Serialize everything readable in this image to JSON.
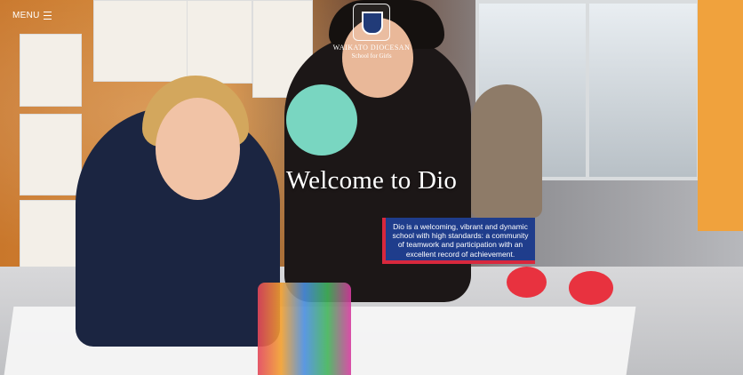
{
  "nav": {
    "menu_label": "MENU"
  },
  "brand": {
    "line1": "WAIKATO DIOCESAN",
    "line2": "School for Girls"
  },
  "hero": {
    "title": "Welcome to Dio",
    "message": "Dio is a welcoming, vibrant and dynamic school with high standards: a community of teamwork and participation with an excellent record of achievement."
  },
  "colors": {
    "banner_bg": "#1f3d8c",
    "banner_accent": "#d8283d",
    "text": "#ffffff"
  },
  "icons": {
    "menu": "hamburger-icon",
    "logo": "school-crest-icon"
  }
}
